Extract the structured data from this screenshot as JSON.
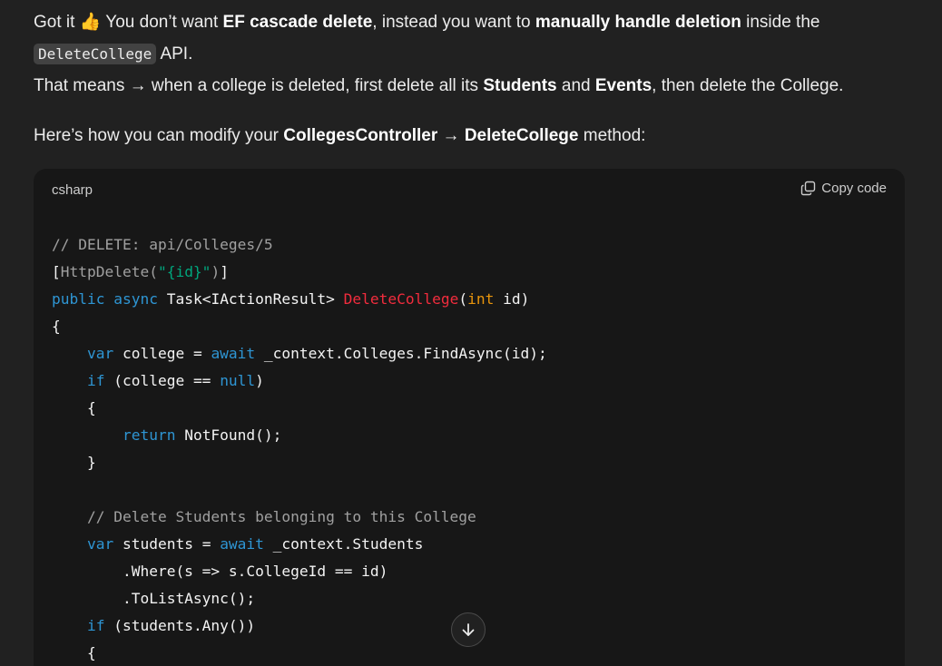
{
  "message": {
    "p1_a": "Got it ",
    "emoji": "👍",
    "p1_b": " You don’t want ",
    "p1_bold1": "EF cascade delete",
    "p1_c": ", instead you want to ",
    "p1_bold2": "manually handle deletion",
    "p1_d": " inside the",
    "p1_code": "DeleteCollege",
    "p1_e": " API.",
    "p2_a": "That means → when a college is deleted, first delete all its ",
    "p2_bold1": "Students",
    "p2_b": " and ",
    "p2_bold2": "Events",
    "p2_c": ", then delete the College.",
    "p3_a": "Here’s how you can modify your ",
    "p3_bold1": "CollegesController",
    "p3_b": " → ",
    "p3_bold2": "DeleteCollege",
    "p3_c": " method:"
  },
  "code_block": {
    "language": "csharp",
    "copy_label": "Copy code",
    "lines": [
      [
        [
          "c-com",
          "// DELETE: api/Colleges/5"
        ]
      ],
      [
        [
          "",
          "["
        ],
        [
          "c-com",
          "HttpDelete("
        ],
        [
          "c-str",
          "\"{id}\""
        ],
        [
          "c-com",
          ")"
        ],
        [
          "",
          "]"
        ]
      ],
      [
        [
          "c-kw",
          "public"
        ],
        [
          "",
          " "
        ],
        [
          "c-kw",
          "async"
        ],
        [
          "",
          " Task<IActionResult> "
        ],
        [
          "c-fn",
          "DeleteCollege"
        ],
        [
          "",
          "("
        ],
        [
          "c-int",
          "int"
        ],
        [
          "",
          " id)"
        ]
      ],
      [
        [
          "",
          "{"
        ]
      ],
      [
        [
          "",
          "    "
        ],
        [
          "c-kw",
          "var"
        ],
        [
          "",
          " college = "
        ],
        [
          "c-kw",
          "await"
        ],
        [
          "",
          " _context.Colleges.FindAsync(id);"
        ]
      ],
      [
        [
          "",
          "    "
        ],
        [
          "c-kw",
          "if"
        ],
        [
          "",
          " (college == "
        ],
        [
          "c-kw",
          "null"
        ],
        [
          "",
          ")"
        ]
      ],
      [
        [
          "",
          "    {"
        ]
      ],
      [
        [
          "",
          "        "
        ],
        [
          "c-kw",
          "return"
        ],
        [
          "",
          " NotFound();"
        ]
      ],
      [
        [
          "",
          "    }"
        ]
      ],
      [
        [
          "",
          ""
        ]
      ],
      [
        [
          "",
          "    "
        ],
        [
          "c-com",
          "// Delete Students belonging to this College"
        ]
      ],
      [
        [
          "",
          "    "
        ],
        [
          "c-kw",
          "var"
        ],
        [
          "",
          " students = "
        ],
        [
          "c-kw",
          "await"
        ],
        [
          "",
          " _context.Students"
        ]
      ],
      [
        [
          "",
          "        .Where(s => s.CollegeId == id)"
        ]
      ],
      [
        [
          "",
          "        .ToListAsync();"
        ]
      ],
      [
        [
          "",
          "    "
        ],
        [
          "c-kw",
          "if"
        ],
        [
          "",
          " (students.Any())"
        ]
      ],
      [
        [
          "",
          "    {"
        ]
      ]
    ]
  },
  "icons": {
    "copy": "copy-icon",
    "scroll_down": "arrow-down-icon"
  },
  "colors": {
    "background": "#212121",
    "code_background": "#171717",
    "keyword": "#2e95d3",
    "string": "#00a67d",
    "function": "#f22c3d",
    "comment": "#a0a0a0",
    "int": "#e9950c"
  }
}
